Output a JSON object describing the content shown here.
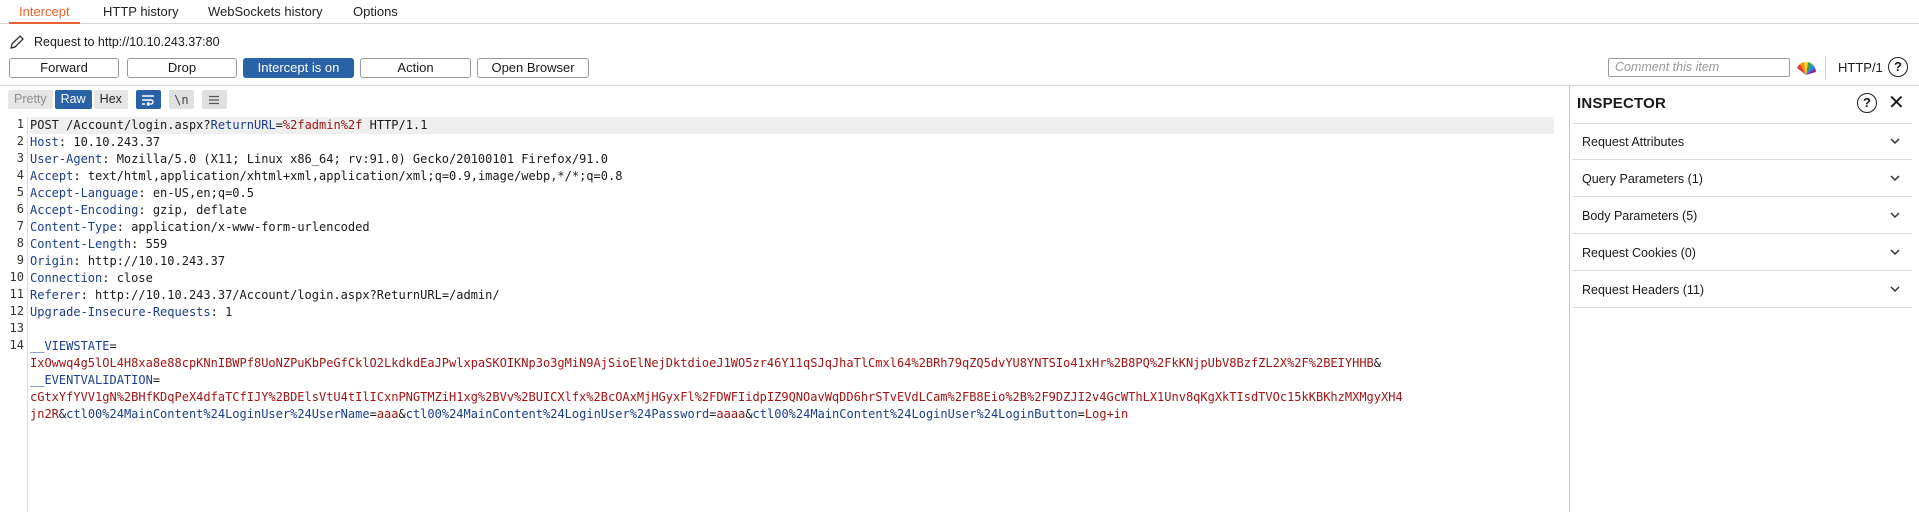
{
  "tabs": [
    "Intercept",
    "HTTP history",
    "WebSockets history",
    "Options"
  ],
  "request_target": "Request to http://10.10.243.37:80",
  "buttons": {
    "forward": "Forward",
    "drop": "Drop",
    "intercept": "Intercept is on",
    "action": "Action",
    "open_browser": "Open Browser"
  },
  "comment_placeholder": "Comment this item",
  "http_version": "HTTP/1",
  "help_glyph": "?",
  "editor_modes": [
    "Pretty",
    "Raw",
    "Hex"
  ],
  "editor_icons": [
    "wrap-lines-icon",
    "newline-icon",
    "menu-icon"
  ],
  "newline_glyph": "\\n",
  "line_numbers": [
    "1",
    "2",
    "3",
    "4",
    "5",
    "6",
    "7",
    "8",
    "9",
    "10",
    "11",
    "12",
    "13",
    "14"
  ],
  "request": {
    "method": "POST",
    "path": "/Account/login.aspx?",
    "query_key": "ReturnURL",
    "query_eq": "=",
    "query_value": "%2fadmin%2f",
    "protocol": " HTTP/1.1",
    "headers": [
      {
        "key": "Host",
        "value": "10.10.243.37"
      },
      {
        "key": "User-Agent",
        "value": "Mozilla/5.0 (X11; Linux x86_64; rv:91.0) Gecko/20100101 Firefox/91.0"
      },
      {
        "key": "Accept",
        "value": "text/html,application/xhtml+xml,application/xml;q=0.9,image/webp,*/*;q=0.8"
      },
      {
        "key": "Accept-Language",
        "value": "en-US,en;q=0.5"
      },
      {
        "key": "Accept-Encoding",
        "value": "gzip, deflate"
      },
      {
        "key": "Content-Type",
        "value": "application/x-www-form-urlencoded"
      },
      {
        "key": "Content-Length",
        "value": "559"
      },
      {
        "key": "Origin",
        "value": "http://10.10.243.37"
      },
      {
        "key": "Connection",
        "value": "close"
      },
      {
        "key": "Referer",
        "value": "http://10.10.243.37/Account/login.aspx?ReturnURL=/admin/"
      },
      {
        "key": "Upgrade-Insecure-Requests",
        "value": "1"
      }
    ],
    "body": {
      "viewstate_key": "__VIEWSTATE",
      "viewstate_value": "IxOwwq4g5lOL4H8xa8e88cpKNnIBWPf8UoNZPuKbPeGfCklO2LkdkdEaJPwlxpaSKOIKNp3o3gMiN9AjSioElNejDktdioeJ1WO5zr46Y11qSJqJhaTlCmxl64%2BRh79qZQ5dvYU8YNTSIo41xHr%2B8PQ%2FkKNjpUbV8BzfZL2X%2F%2BEIYHHB",
      "amp": "&",
      "eventval_key": "__EVENTVALIDATION",
      "eventval_value_1": "cGtxYfYVV1gN%2BHfKDqPeX4dfaTCfIJY%2BDElsVtU4tIlICxnPNGTMZiH1xg%2BVv%2BUICXlfx%2BcOAxMjHGyxFl%2FDWFIidpIZ9QNOavWqDD6hrSTvEVdLCam%2FB8Eio%2B%2F9DZJI2v4GcWThLX1Unv8qKgXkTIsdTVOc15kKBKhzMXMgyXH4",
      "eventval_value_2": "jn2R",
      "user_key": "ctl00%24MainContent%24LoginUser%24UserName",
      "user_value": "aaa",
      "pass_key": "ctl00%24MainContent%24LoginUser%24Password",
      "pass_value": "aaaa",
      "btn_key": "ctl00%24MainContent%24LoginUser%24LoginButton",
      "btn_value": "Log+in",
      "eq": "="
    }
  },
  "inspector": {
    "title": "INSPECTOR",
    "close_glyph": "✕",
    "sections": [
      "Request Attributes",
      "Query Parameters (1)",
      "Body Parameters (5)",
      "Request Cookies (0)",
      "Request Headers (11)"
    ]
  }
}
